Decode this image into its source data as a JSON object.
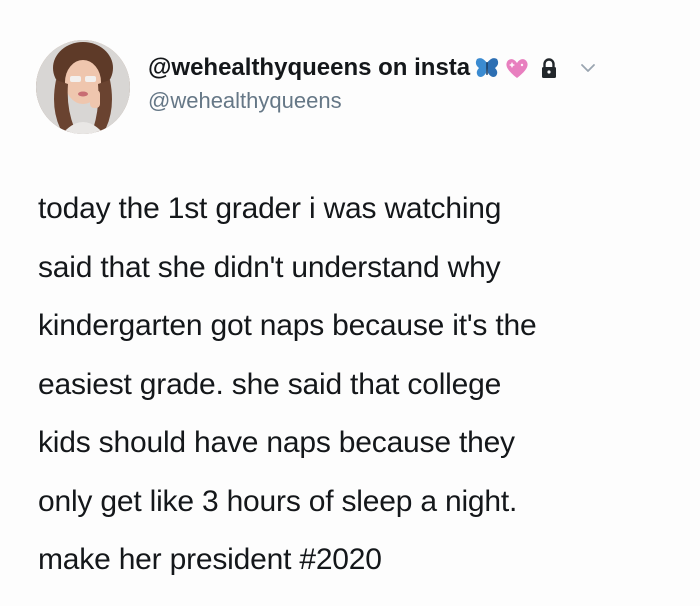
{
  "tweet": {
    "display_name": "@wehealthyqueens on insta",
    "handle": "@wehealthyqueens",
    "emoji": [
      "butterfly-icon",
      "sparkling-heart-icon"
    ],
    "verified_lock": "lock-icon",
    "menu": "chevron-down-icon",
    "text_lines": [
      "today the 1st grader i was watching",
      "said that she didn't understand why",
      "kindergarten got naps because it's the",
      "easiest grade. she said that college",
      "kids should have naps because they",
      "only get like 3 hours of sleep a night.",
      "make her president #2020"
    ],
    "colors": {
      "text": "#14171a",
      "handle": "#657786",
      "butterfly": "#3b8bd1",
      "heart": "#e87fbf",
      "lock": "#22272b",
      "chevron": "#9aa5b0"
    }
  }
}
